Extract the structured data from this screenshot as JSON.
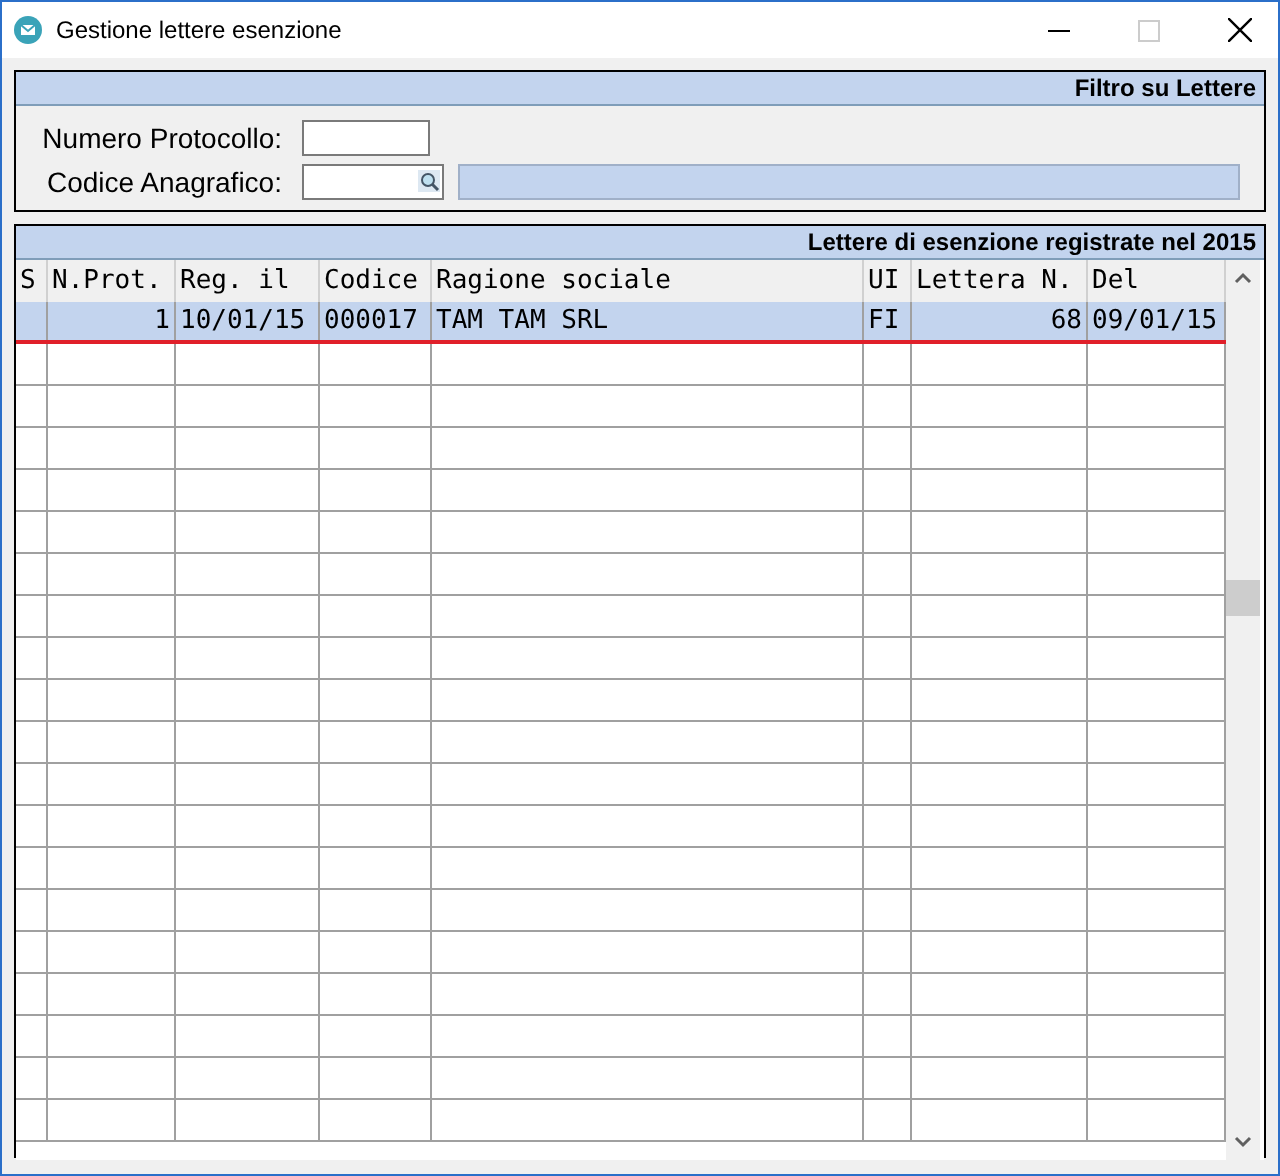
{
  "window": {
    "title": "Gestione lettere esenzione"
  },
  "filter": {
    "title": "Filtro su Lettere",
    "fields": [
      {
        "label": "Numero Protocollo:",
        "kind": "text"
      },
      {
        "label": "Codice Anagrafico:",
        "kind": "lookup"
      }
    ]
  },
  "table": {
    "title": "Lettere di esenzione registrate nel 2015",
    "columns": [
      {
        "label": "S"
      },
      {
        "label": "N.Prot."
      },
      {
        "label": "Reg. il"
      },
      {
        "label": "Codice"
      },
      {
        "label": "Ragione sociale"
      },
      {
        "label": "UI"
      },
      {
        "label": "Lettera N."
      },
      {
        "label": "Del"
      }
    ],
    "rows": [
      {
        "selected": true,
        "cells": [
          "",
          "1",
          "10/01/15",
          "000017",
          "TAM TAM SRL",
          "FI",
          "68",
          "09/01/15"
        ]
      }
    ]
  }
}
